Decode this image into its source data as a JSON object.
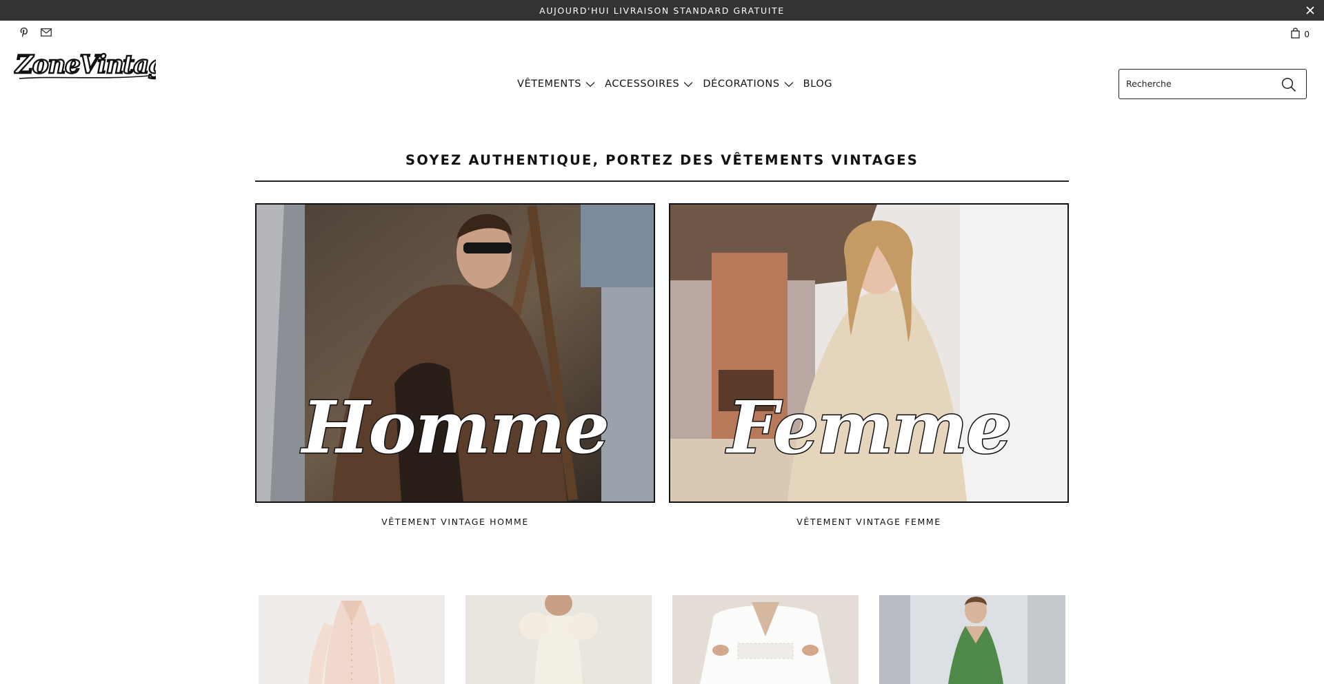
{
  "announcement": {
    "text": "AUJOURD'HUI LIVRAISON STANDARD GRATUITE"
  },
  "header": {
    "social_icons": [
      "pinterest-icon",
      "mail-icon"
    ],
    "cart_count": "0",
    "logo_text": "ZoneVintage"
  },
  "nav": {
    "items": [
      {
        "label": "VÊTEMENTS",
        "has_dropdown": true
      },
      {
        "label": "ACCESSOIRES",
        "has_dropdown": true
      },
      {
        "label": "DÉCORATIONS",
        "has_dropdown": true
      },
      {
        "label": "BLOG",
        "has_dropdown": false
      }
    ]
  },
  "search": {
    "placeholder": "Recherche"
  },
  "hero": {
    "heading": "SOYEZ AUTHENTIQUE, PORTEZ DES VÊTEMENTS VINTAGES",
    "collections": [
      {
        "script": "Homme",
        "caption": "VÊTEMENT VINTAGE HOMME"
      },
      {
        "script": "Femme",
        "caption": "VÊTEMENT VINTAGE FEMME"
      }
    ]
  },
  "colors": {
    "announcement_bg": "#333333",
    "text": "#111111",
    "border": "#222222"
  }
}
